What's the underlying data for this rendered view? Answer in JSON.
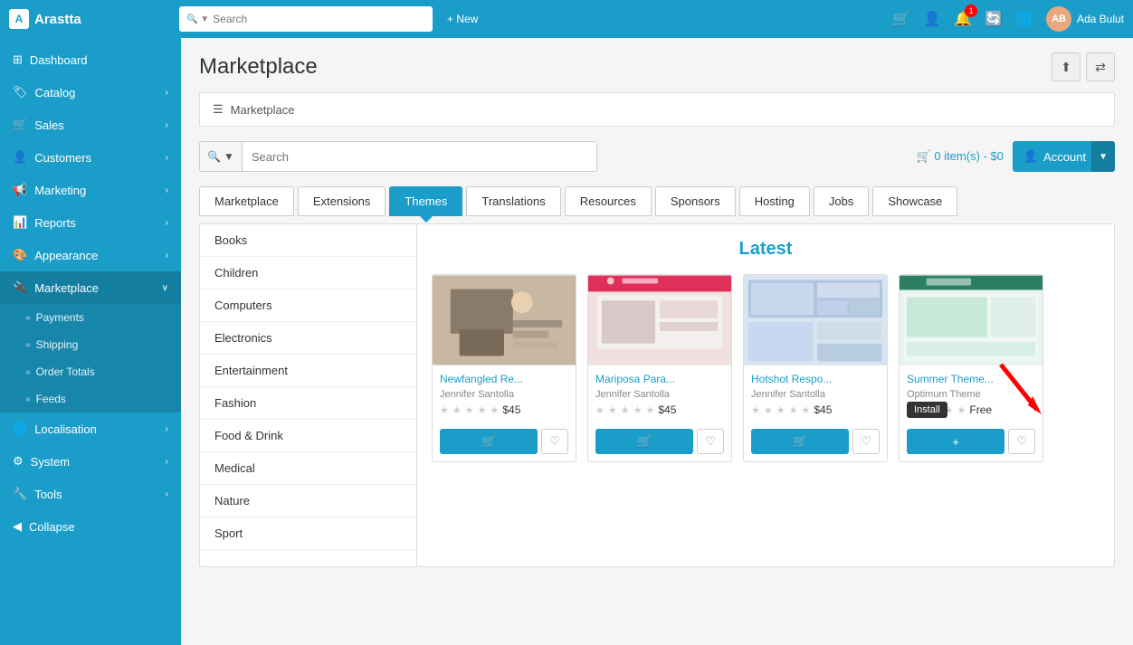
{
  "brand": {
    "icon": "A",
    "name": "Arastta"
  },
  "topnav": {
    "search_placeholder": "Search",
    "new_label": "+ New",
    "notification_count": "1",
    "user_name": "Ada Bulut",
    "user_initials": "AB"
  },
  "sidebar": {
    "items": [
      {
        "id": "dashboard",
        "icon": "⊞",
        "label": "Dashboard",
        "has_children": false
      },
      {
        "id": "catalog",
        "icon": "🏷",
        "label": "Catalog",
        "has_children": true
      },
      {
        "id": "sales",
        "icon": "🛒",
        "label": "Sales",
        "has_children": true
      },
      {
        "id": "customers",
        "icon": "👤",
        "label": "Customers",
        "has_children": true
      },
      {
        "id": "marketing",
        "icon": "📢",
        "label": "Marketing",
        "has_children": true
      },
      {
        "id": "reports",
        "icon": "📊",
        "label": "Reports",
        "has_children": true
      },
      {
        "id": "appearance",
        "icon": "🎨",
        "label": "Appearance",
        "has_children": true
      },
      {
        "id": "marketplace",
        "icon": "🔌",
        "label": "Marketplace",
        "has_children": true,
        "active": true
      },
      {
        "id": "localisation",
        "icon": "🌐",
        "label": "Localisation",
        "has_children": true
      },
      {
        "id": "system",
        "icon": "⚙",
        "label": "System",
        "has_children": true
      },
      {
        "id": "tools",
        "icon": "🔧",
        "label": "Tools",
        "has_children": true
      }
    ],
    "sub_items": [
      {
        "label": "Payments"
      },
      {
        "label": "Shipping"
      },
      {
        "label": "Order Totals"
      },
      {
        "label": "Feeds"
      }
    ],
    "collapse_label": "Collapse"
  },
  "page": {
    "title": "Marketplace",
    "breadcrumb": "Marketplace"
  },
  "search": {
    "placeholder": "Search",
    "cart_text": "0 item(s) - $0",
    "account_label": "Account"
  },
  "tabs": [
    {
      "id": "marketplace",
      "label": "Marketplace",
      "active": false
    },
    {
      "id": "extensions",
      "label": "Extensions",
      "active": false
    },
    {
      "id": "themes",
      "label": "Themes",
      "active": true
    },
    {
      "id": "translations",
      "label": "Translations",
      "active": false
    },
    {
      "id": "resources",
      "label": "Resources",
      "active": false
    },
    {
      "id": "sponsors",
      "label": "Sponsors",
      "active": false
    },
    {
      "id": "hosting",
      "label": "Hosting",
      "active": false
    },
    {
      "id": "jobs",
      "label": "Jobs",
      "active": false
    },
    {
      "id": "showcase",
      "label": "Showcase",
      "active": false
    }
  ],
  "categories": [
    "Books",
    "Children",
    "Computers",
    "Electronics",
    "Entertainment",
    "Fashion",
    "Food & Drink",
    "Medical",
    "Nature",
    "Sport"
  ],
  "products_section": {
    "title": "Latest",
    "items": [
      {
        "name": "Newfangled Re...",
        "author": "Jennifer Santolla",
        "price": "$45",
        "rating": 0,
        "color1": "#c8b8a2",
        "color2": "#5a4a3a"
      },
      {
        "name": "Mariposa Para...",
        "author": "Jennifer Santolla",
        "price": "$45",
        "rating": 0,
        "color1": "#e8d0d0",
        "color2": "#c0305a"
      },
      {
        "name": "Hotshot Respo...",
        "author": "Jennifer Santolla",
        "price": "$45",
        "rating": 0,
        "color1": "#d0d8e8",
        "color2": "#405080"
      },
      {
        "name": "Summer Theme...",
        "author": "Optimum Theme",
        "price": "Free",
        "rating": 0,
        "color1": "#d8f0e8",
        "color2": "#2a8060",
        "has_install_tooltip": true
      }
    ],
    "install_tooltip": "Install",
    "add_icon": "+"
  }
}
